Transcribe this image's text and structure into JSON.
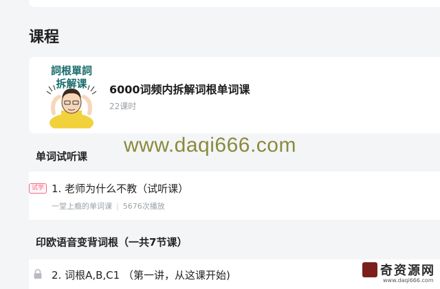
{
  "section": {
    "title": "课程"
  },
  "course": {
    "thumb_line1": "詞根單詞",
    "thumb_line2": "拆解课",
    "title": "6000词频内拆解词根单词课",
    "meta": "22课时"
  },
  "watermark": "www.daqi666.com",
  "chapters": [
    {
      "title": "单词试听课",
      "lessons": [
        {
          "badge": "试学",
          "title": "1. 老师为什么不教（试听课）",
          "sub_a": "一堂上瘾的单词课",
          "sub_b": "5676次播放"
        }
      ]
    },
    {
      "title": "印欧语音变背词根（一共7节课）",
      "lessons": [
        {
          "title": "2. 词根A,B,C1 （第一讲，从这课开始)"
        }
      ]
    }
  ],
  "logo": {
    "text": "奇资源网",
    "url": "www.daqi666.com"
  },
  "colors": {
    "badge": "#f06a86",
    "watermark": "#8a8a3c",
    "thumb_text": "#166c6b"
  }
}
